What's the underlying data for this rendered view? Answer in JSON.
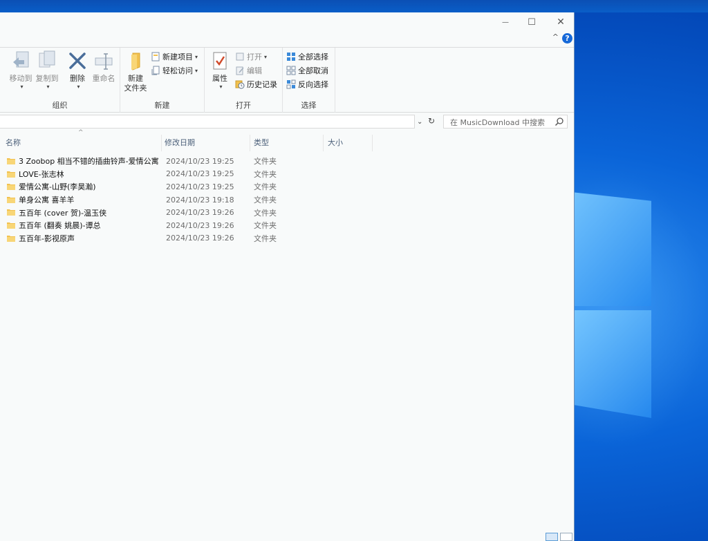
{
  "window": {
    "minimize_glyph": "—",
    "maximize_glyph": "☐",
    "close_glyph": "✕",
    "collapse_glyph": "^",
    "help_glyph": "?"
  },
  "ribbon": {
    "organize": {
      "label": "组织",
      "move_to": "移动到",
      "copy_to": "复制到",
      "delete": "删除",
      "rename": "重命名"
    },
    "new": {
      "label": "新建",
      "new_folder_line1": "新建",
      "new_folder_line2": "文件夹",
      "new_item": "新建项目",
      "easy_access": "轻松访问"
    },
    "open": {
      "label": "打开",
      "properties": "属性",
      "open": "打开",
      "edit": "编辑",
      "history": "历史记录"
    },
    "select": {
      "label": "选择",
      "select_all": "全部选择",
      "select_none": "全部取消",
      "invert": "反向选择"
    }
  },
  "address": {
    "search_placeholder": "在 MusicDownload 中搜索"
  },
  "columns": {
    "name": "名称",
    "date": "修改日期",
    "type": "类型",
    "size": "大小"
  },
  "files": [
    {
      "name": "3 Zoobop 相当不错的插曲铃声-爱情公寓",
      "date": "2024/10/23 19:25",
      "type": "文件夹"
    },
    {
      "name": "LOVE-张志林",
      "date": "2024/10/23 19:25",
      "type": "文件夹"
    },
    {
      "name": "爱情公寓-山野(李昊瀚)",
      "date": "2024/10/23 19:25",
      "type": "文件夹"
    },
    {
      "name": "单身公寓 喜羊羊",
      "date": "2024/10/23 19:18",
      "type": "文件夹"
    },
    {
      "name": "五百年 (cover 贺)-温玉侠",
      "date": "2024/10/23 19:26",
      "type": "文件夹"
    },
    {
      "name": "五百年 (翻奏 姚晨)-谭总",
      "date": "2024/10/23 19:26",
      "type": "文件夹"
    },
    {
      "name": "五百年-影视原声",
      "date": "2024/10/23 19:26",
      "type": "文件夹"
    }
  ],
  "colors": {
    "folder": "#f2c14e",
    "accent": "#1769d8"
  }
}
